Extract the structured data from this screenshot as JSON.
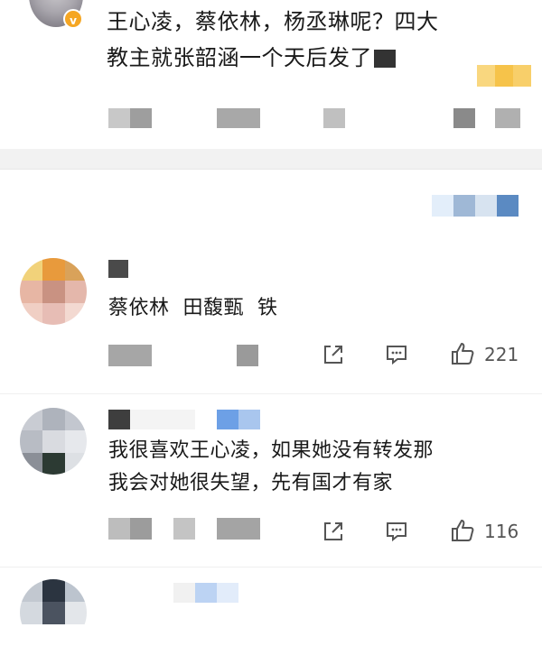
{
  "comments": [
    {
      "text_line1": "王心凌，蔡依林，杨丞琳呢？四大",
      "text_line2": "教主就张韶涵一个天后发了"
    },
    {
      "text": "蔡依林  田馥甄  铁",
      "likes": "221"
    },
    {
      "text_line1": "我很喜欢王心凌，如果她没有转发那",
      "text_line2": "我会对她很失望，先有国才有家",
      "likes": "116"
    }
  ],
  "icons": {
    "share": "share-icon",
    "reply": "comment-icon",
    "like": "thumbs-up-icon",
    "verified": "verified-badge-icon"
  },
  "badge": "v",
  "colors": {
    "verified_badge": "#f5a623",
    "text": "#1a1a1a",
    "meta": "#555555",
    "divider": "#f2f2f2"
  }
}
